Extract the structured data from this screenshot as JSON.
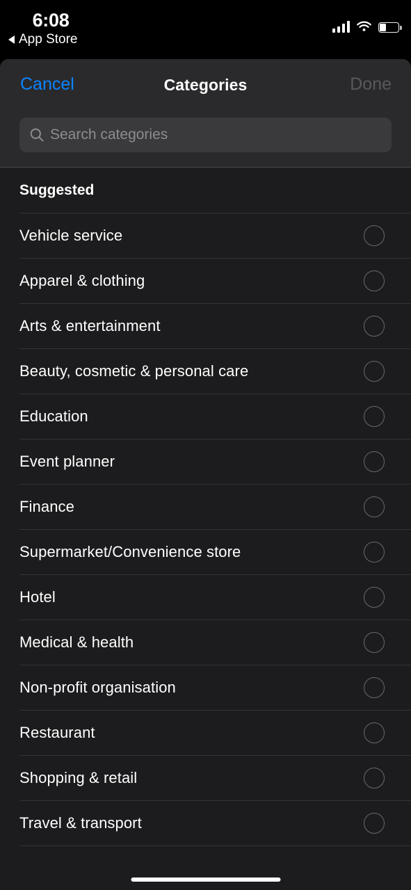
{
  "status_bar": {
    "time": "6:08",
    "back_label": "App Store",
    "back_icon": "triangle-left-icon",
    "signal_icon": "cellular-signal-icon",
    "wifi_icon": "wifi-icon",
    "battery_icon": "battery-icon",
    "battery_level_percent": 35
  },
  "nav": {
    "cancel_label": "Cancel",
    "title": "Categories",
    "done_label": "Done",
    "done_enabled": false
  },
  "search": {
    "icon": "search-icon",
    "placeholder": "Search categories",
    "value": ""
  },
  "list": {
    "section_header": "Suggested",
    "selection_control": "radio-circle-unselected",
    "items": [
      {
        "label": "Vehicle service",
        "selected": false
      },
      {
        "label": "Apparel & clothing",
        "selected": false
      },
      {
        "label": "Arts & entertainment",
        "selected": false
      },
      {
        "label": "Beauty, cosmetic & personal care",
        "selected": false
      },
      {
        "label": "Education",
        "selected": false
      },
      {
        "label": "Event planner",
        "selected": false
      },
      {
        "label": "Finance",
        "selected": false
      },
      {
        "label": "Supermarket/Convenience store",
        "selected": false
      },
      {
        "label": "Hotel",
        "selected": false
      },
      {
        "label": "Medical & health",
        "selected": false
      },
      {
        "label": "Non-profit organisation",
        "selected": false
      },
      {
        "label": "Restaurant",
        "selected": false
      },
      {
        "label": "Shopping & retail",
        "selected": false
      },
      {
        "label": "Travel & transport",
        "selected": false
      }
    ]
  },
  "home_indicator": "home-indicator-bar",
  "colors": {
    "accent_blue": "#0a84ff",
    "disabled_grey": "#59595d",
    "sheet_background": "#1c1c1e",
    "header_background": "#2a2a2c",
    "search_field": "#3a3a3c",
    "separator": "#343436",
    "radio_stroke": "#6a6a6c",
    "placeholder_text": "#8c8c91"
  }
}
